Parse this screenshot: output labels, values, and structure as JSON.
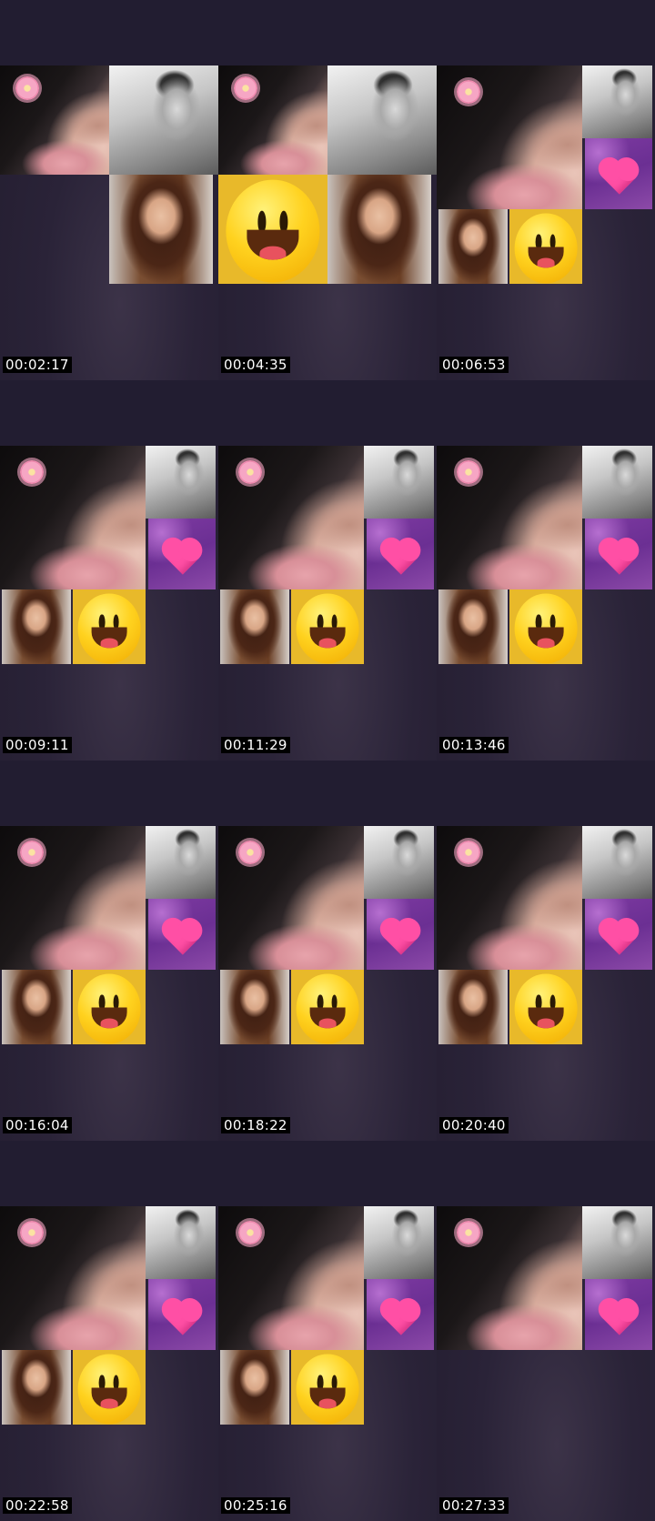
{
  "thumbnails": [
    {
      "timestamp": "00:02:17",
      "layout": "early"
    },
    {
      "timestamp": "00:04:35",
      "layout": "mid"
    },
    {
      "timestamp": "00:06:53",
      "layout": "full"
    },
    {
      "timestamp": "00:09:11",
      "layout": "full"
    },
    {
      "timestamp": "00:11:29",
      "layout": "full"
    },
    {
      "timestamp": "00:13:46",
      "layout": "full"
    },
    {
      "timestamp": "00:16:04",
      "layout": "full"
    },
    {
      "timestamp": "00:18:22",
      "layout": "full"
    },
    {
      "timestamp": "00:20:40",
      "layout": "full"
    },
    {
      "timestamp": "00:22:58",
      "layout": "full"
    },
    {
      "timestamp": "00:25:16",
      "layout": "full"
    },
    {
      "timestamp": "00:27:33",
      "layout": "partial"
    }
  ],
  "colors": {
    "background": "#2a2436",
    "timestamp_bg": "#000000",
    "timestamp_fg": "#ffffff"
  },
  "icons": {
    "flower": "flower-icon",
    "heart": "heart-icon",
    "smiley": "smiley-icon"
  }
}
